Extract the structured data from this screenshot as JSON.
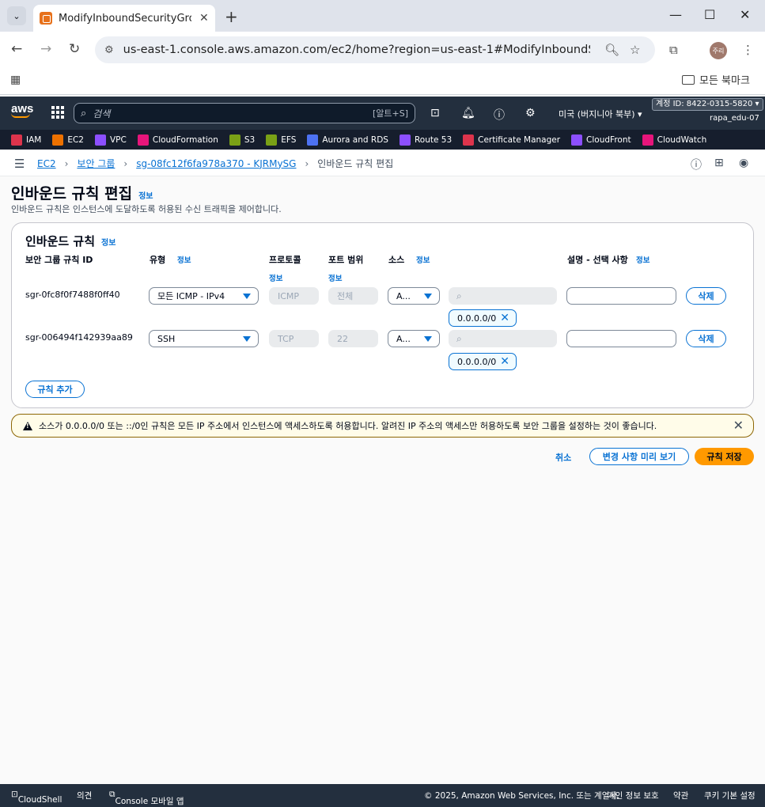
{
  "browser": {
    "tab_title": "ModifyInboundSecurityGroupR",
    "url": "us-east-1.console.aws.amazon.com/ec2/home?region=us-east-1#ModifyInboundSecurityGr...",
    "profile_label": "주리",
    "bookmarks_folder": "모든 북마크"
  },
  "aws": {
    "search_placeholder": "검색",
    "search_shortcut": "[알트+S]",
    "region": "미국 (버지니아 북부) ▾",
    "account": "계정 ID: 8422-0315-5820 ▾",
    "user": "rapa_edu-07",
    "favorites": [
      {
        "label": "IAM",
        "color": "#dd344c"
      },
      {
        "label": "EC2",
        "color": "#ed7100"
      },
      {
        "label": "VPC",
        "color": "#8c4fff"
      },
      {
        "label": "CloudFormation",
        "color": "#e7157b"
      },
      {
        "label": "S3",
        "color": "#7aa116"
      },
      {
        "label": "EFS",
        "color": "#7aa116"
      },
      {
        "label": "Aurora and RDS",
        "color": "#4d72f3"
      },
      {
        "label": "Route 53",
        "color": "#8c4fff"
      },
      {
        "label": "Certificate Manager",
        "color": "#dd344c"
      },
      {
        "label": "CloudFront",
        "color": "#8c4fff"
      },
      {
        "label": "CloudWatch",
        "color": "#e7157b"
      }
    ]
  },
  "breadcrumb": {
    "items": [
      "EC2",
      "보안 그룹",
      "sg-08fc12f6fa978a370 - KJRMySG"
    ],
    "current": "인바운드 규칙 편집"
  },
  "page": {
    "title": "인바운드 규칙 편집",
    "info": "정보",
    "description": "인바운드 규칙은 인스턴스에 도달하도록 허용된 수신 트래픽을 제어합니다."
  },
  "panel": {
    "title": "인바운드 규칙",
    "info": "정보",
    "columns": {
      "rule_id": "보안 그룹 규칙 ID",
      "type": "유형",
      "protocol": "프로토콜",
      "port_range": "포트 범위",
      "source": "소스",
      "description": "설명 - 선택 사항",
      "info": "정보"
    },
    "rules": [
      {
        "id": "sgr-0fc8f0f7488f0ff40",
        "type": "모든 ICMP - IPv4",
        "protocol": "ICMP",
        "port": "전체",
        "source": "A...",
        "cidr": "0.0.0.0/0",
        "delete": "삭제"
      },
      {
        "id": "sgr-006494f142939aa89",
        "type": "SSH",
        "protocol": "TCP",
        "port": "22",
        "source": "A...",
        "cidr": "0.0.0.0/0",
        "delete": "삭제"
      }
    ],
    "add_rule": "규칙 추가"
  },
  "alert": {
    "message": "소스가 0.0.0.0/0 또는 ::/0인 규칙은 모든 IP 주소에서 인스턴스에 액세스하도록 허용합니다. 알려진 IP 주소의 액세스만 허용하도록 보안 그룹을 설정하는 것이 좋습니다."
  },
  "actions": {
    "cancel": "취소",
    "preview": "변경 사항 미리 보기",
    "save": "규칙 저장"
  },
  "footer": {
    "cloudshell": "CloudShell",
    "feedback": "의견",
    "mobile": "Console 모바일 앱",
    "copyright": "© 2025, Amazon Web Services, Inc. 또는 계열사.",
    "privacy": "개인 정보 보호",
    "terms": "약관",
    "cookies": "쿠키 기본 설정"
  }
}
